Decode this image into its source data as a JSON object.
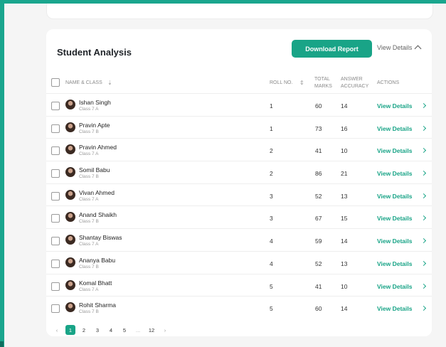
{
  "card": {
    "title": "Student Analysis",
    "download_label": "Download Report",
    "view_details_label": "View Details"
  },
  "headers": {
    "name_class": "NAME & CLASS",
    "sort_down": "⇣",
    "roll_no": "ROLL NO.",
    "sort_updown": "⇕",
    "total_marks_1": "TOTAL",
    "total_marks_2": "MARKS",
    "accuracy_1": "ANSWER",
    "accuracy_2": "ACCURACY",
    "actions": "ACTIONS"
  },
  "rows": [
    {
      "name": "Ishan Singh",
      "cls": "Class 7 A",
      "roll": "1",
      "marks": "60",
      "acc": "14",
      "action": "View Details"
    },
    {
      "name": "Pravin Apte",
      "cls": "Class 7 B",
      "roll": "1",
      "marks": "73",
      "acc": "16",
      "action": "View Details"
    },
    {
      "name": "Pravin Ahmed",
      "cls": "Class 7 A",
      "roll": "2",
      "marks": "41",
      "acc": "10",
      "action": "View Details"
    },
    {
      "name": "Somil Babu",
      "cls": "Class 7 B",
      "roll": "2",
      "marks": "86",
      "acc": "21",
      "action": "View Details"
    },
    {
      "name": "Vivan Ahmed",
      "cls": "Class 7 A",
      "roll": "3",
      "marks": "52",
      "acc": "13",
      "action": "View Details"
    },
    {
      "name": "Anand Shaikh",
      "cls": "Class 7 B",
      "roll": "3",
      "marks": "67",
      "acc": "15",
      "action": "View Details"
    },
    {
      "name": "Shantay Biswas",
      "cls": "Class 7 A",
      "roll": "4",
      "marks": "59",
      "acc": "14",
      "action": "View Details"
    },
    {
      "name": "Ananya Babu",
      "cls": "Class 7 B",
      "roll": "4",
      "marks": "52",
      "acc": "13",
      "action": "View Details"
    },
    {
      "name": "Komal Bhatt",
      "cls": "Class 7 A",
      "roll": "5",
      "marks": "41",
      "acc": "10",
      "action": "View Details"
    },
    {
      "name": "Rohit Sharma",
      "cls": "Class 7 B",
      "roll": "5",
      "marks": "60",
      "acc": "14",
      "action": "View Details"
    }
  ],
  "pagination": {
    "prev": "‹",
    "pages": [
      "1",
      "2",
      "3",
      "4",
      "5"
    ],
    "ellipsis": "...",
    "last": "12",
    "next": "›",
    "active": "1"
  },
  "colors": {
    "accent": "#19a487",
    "frame": "#1aa68e"
  }
}
